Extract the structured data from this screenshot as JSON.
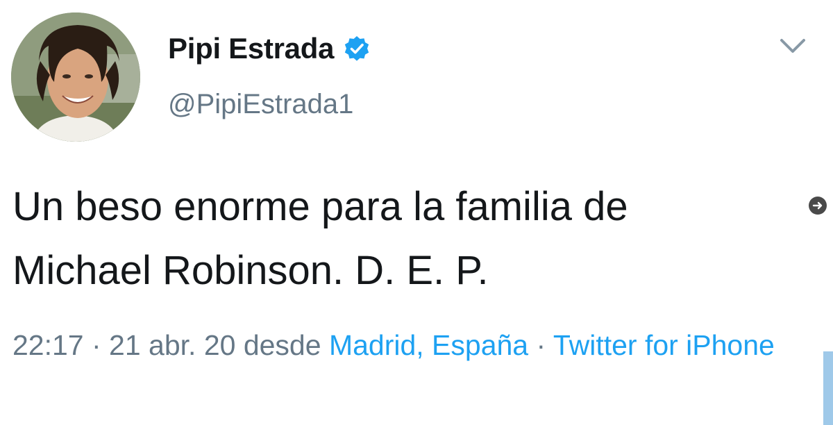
{
  "user": {
    "display_name": "Pipi Estrada",
    "handle": "@PipiEstrada1",
    "verified": true
  },
  "tweet": {
    "text_line1": "Un beso enorme para la familia de",
    "text_line2": "Michael Robinson. D. E. P.",
    "time": "22:17",
    "separator": " · ",
    "date": "21 abr. 20",
    "from_word": " desde ",
    "location": "Madrid, España",
    "source": "Twitter for iPhone"
  },
  "icons": {
    "verified": "verified-badge-icon",
    "menu": "chevron-down-icon",
    "more": "arrow-circle-icon"
  },
  "colors": {
    "text": "#14171a",
    "secondary": "#657786",
    "link": "#1da1f2",
    "verified": "#1da1f2"
  }
}
